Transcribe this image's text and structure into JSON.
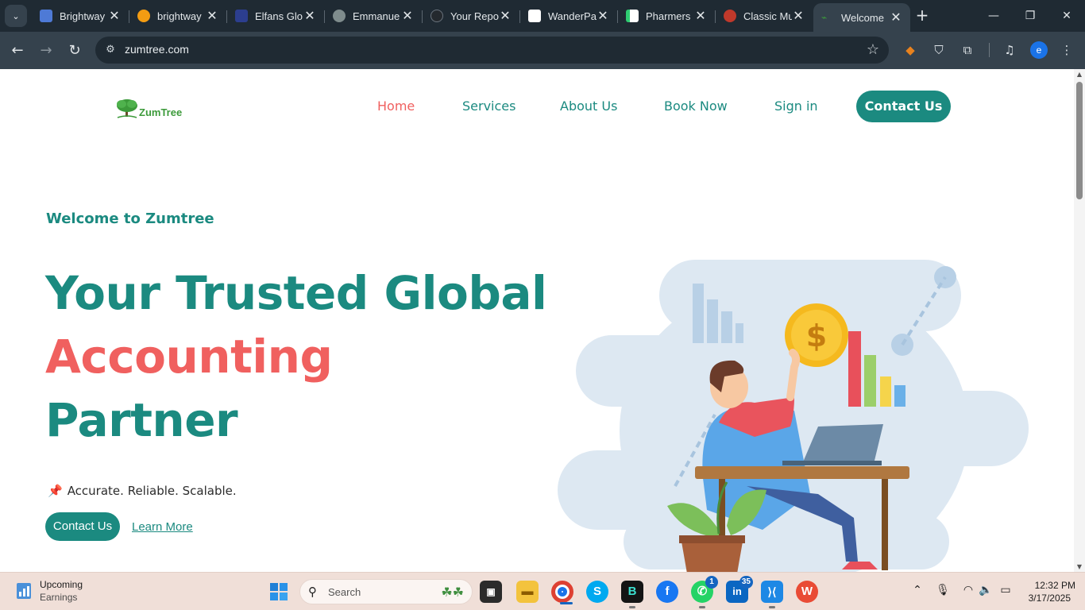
{
  "browser": {
    "tabs": [
      {
        "title": "Brightway",
        "favicon_color": "#4e7ad6"
      },
      {
        "title": "brightway",
        "favicon_color": "#f39c12"
      },
      {
        "title": "Elfans Glo",
        "favicon_color": "#2c3e8f"
      },
      {
        "title": "Emmanue",
        "favicon_color": "#7f8c8d"
      },
      {
        "title": "Your Repo",
        "favicon_color": "#24292e"
      },
      {
        "title": "WanderPa",
        "favicon_color": "#ffffff"
      },
      {
        "title": "Pharmers",
        "favicon_color": "#2ecc71"
      },
      {
        "title": "Classic Mu",
        "favicon_color": "#c0392b"
      },
      {
        "title": "Welcome",
        "favicon_color": "#3c9a3a",
        "active": true
      }
    ],
    "close_glyph": "✕",
    "new_tab_glyph": "+",
    "url": "zumtree.com"
  },
  "site": {
    "logo_text": "ZumTree",
    "nav": {
      "home": "Home",
      "services": "Services",
      "about": "About Us",
      "book": "Book Now",
      "signin": "Sign in",
      "contact": "Contact Us"
    },
    "hero": {
      "eyebrow": "Welcome to Zumtree",
      "line1": "Your Trusted Global",
      "line2": "Accounting",
      "line3": "Partner",
      "tagline": "Accurate. Reliable. Scalable.",
      "cta": "Contact Us",
      "learn_more": "Learn More"
    },
    "colors": {
      "primary": "#1b8a80",
      "accent": "#f0605f"
    }
  },
  "taskbar": {
    "weather_title": "Upcoming",
    "weather_sub": "Earnings",
    "search_placeholder": "Search",
    "whatsapp_badge": "1",
    "linkedin_badge": "35",
    "time": "12:32 PM",
    "date": "3/17/2025"
  }
}
